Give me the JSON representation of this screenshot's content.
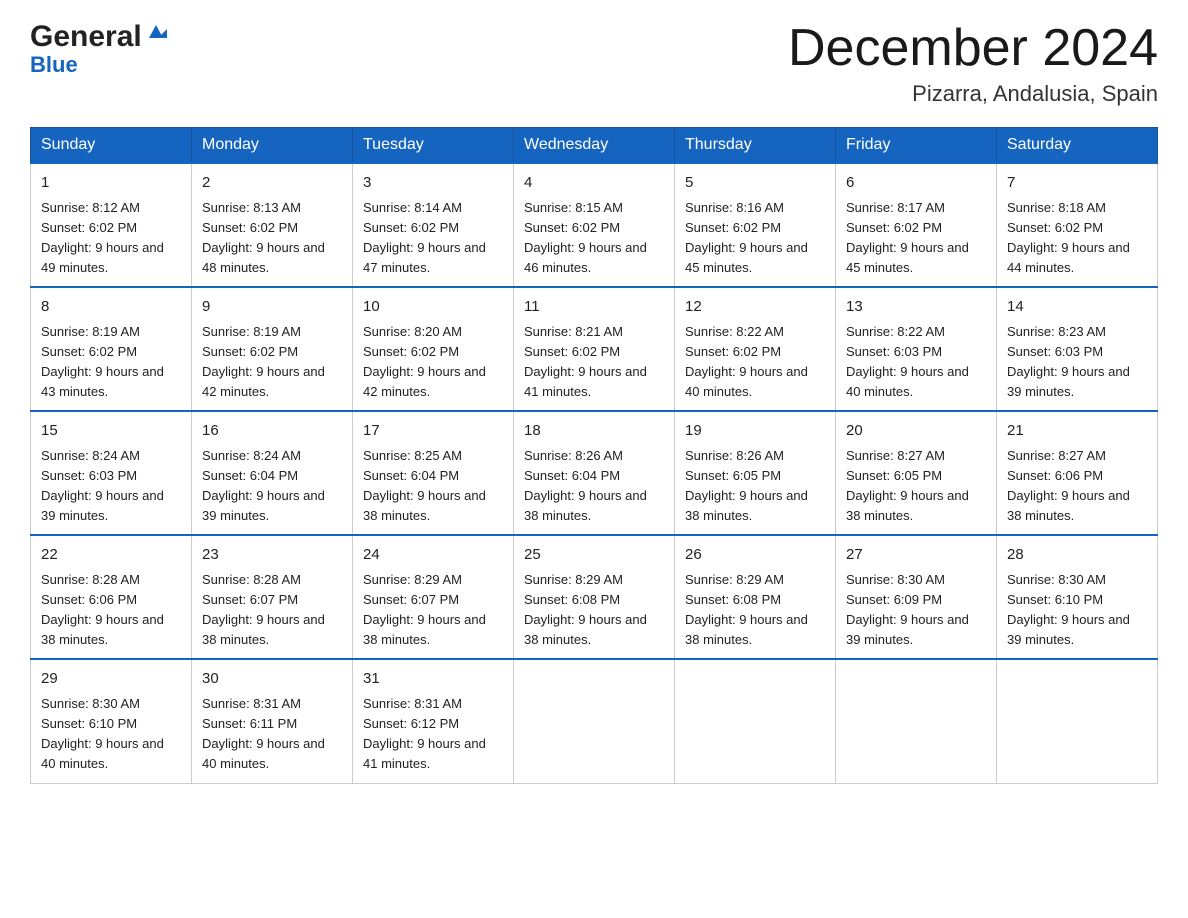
{
  "header": {
    "logo_general": "General",
    "logo_blue": "Blue",
    "month_title": "December 2024",
    "location": "Pizarra, Andalusia, Spain"
  },
  "days_of_week": [
    "Sunday",
    "Monday",
    "Tuesday",
    "Wednesday",
    "Thursday",
    "Friday",
    "Saturday"
  ],
  "weeks": [
    [
      {
        "day": "1",
        "sunrise": "Sunrise: 8:12 AM",
        "sunset": "Sunset: 6:02 PM",
        "daylight": "Daylight: 9 hours and 49 minutes."
      },
      {
        "day": "2",
        "sunrise": "Sunrise: 8:13 AM",
        "sunset": "Sunset: 6:02 PM",
        "daylight": "Daylight: 9 hours and 48 minutes."
      },
      {
        "day": "3",
        "sunrise": "Sunrise: 8:14 AM",
        "sunset": "Sunset: 6:02 PM",
        "daylight": "Daylight: 9 hours and 47 minutes."
      },
      {
        "day": "4",
        "sunrise": "Sunrise: 8:15 AM",
        "sunset": "Sunset: 6:02 PM",
        "daylight": "Daylight: 9 hours and 46 minutes."
      },
      {
        "day": "5",
        "sunrise": "Sunrise: 8:16 AM",
        "sunset": "Sunset: 6:02 PM",
        "daylight": "Daylight: 9 hours and 45 minutes."
      },
      {
        "day": "6",
        "sunrise": "Sunrise: 8:17 AM",
        "sunset": "Sunset: 6:02 PM",
        "daylight": "Daylight: 9 hours and 45 minutes."
      },
      {
        "day": "7",
        "sunrise": "Sunrise: 8:18 AM",
        "sunset": "Sunset: 6:02 PM",
        "daylight": "Daylight: 9 hours and 44 minutes."
      }
    ],
    [
      {
        "day": "8",
        "sunrise": "Sunrise: 8:19 AM",
        "sunset": "Sunset: 6:02 PM",
        "daylight": "Daylight: 9 hours and 43 minutes."
      },
      {
        "day": "9",
        "sunrise": "Sunrise: 8:19 AM",
        "sunset": "Sunset: 6:02 PM",
        "daylight": "Daylight: 9 hours and 42 minutes."
      },
      {
        "day": "10",
        "sunrise": "Sunrise: 8:20 AM",
        "sunset": "Sunset: 6:02 PM",
        "daylight": "Daylight: 9 hours and 42 minutes."
      },
      {
        "day": "11",
        "sunrise": "Sunrise: 8:21 AM",
        "sunset": "Sunset: 6:02 PM",
        "daylight": "Daylight: 9 hours and 41 minutes."
      },
      {
        "day": "12",
        "sunrise": "Sunrise: 8:22 AM",
        "sunset": "Sunset: 6:02 PM",
        "daylight": "Daylight: 9 hours and 40 minutes."
      },
      {
        "day": "13",
        "sunrise": "Sunrise: 8:22 AM",
        "sunset": "Sunset: 6:03 PM",
        "daylight": "Daylight: 9 hours and 40 minutes."
      },
      {
        "day": "14",
        "sunrise": "Sunrise: 8:23 AM",
        "sunset": "Sunset: 6:03 PM",
        "daylight": "Daylight: 9 hours and 39 minutes."
      }
    ],
    [
      {
        "day": "15",
        "sunrise": "Sunrise: 8:24 AM",
        "sunset": "Sunset: 6:03 PM",
        "daylight": "Daylight: 9 hours and 39 minutes."
      },
      {
        "day": "16",
        "sunrise": "Sunrise: 8:24 AM",
        "sunset": "Sunset: 6:04 PM",
        "daylight": "Daylight: 9 hours and 39 minutes."
      },
      {
        "day": "17",
        "sunrise": "Sunrise: 8:25 AM",
        "sunset": "Sunset: 6:04 PM",
        "daylight": "Daylight: 9 hours and 38 minutes."
      },
      {
        "day": "18",
        "sunrise": "Sunrise: 8:26 AM",
        "sunset": "Sunset: 6:04 PM",
        "daylight": "Daylight: 9 hours and 38 minutes."
      },
      {
        "day": "19",
        "sunrise": "Sunrise: 8:26 AM",
        "sunset": "Sunset: 6:05 PM",
        "daylight": "Daylight: 9 hours and 38 minutes."
      },
      {
        "day": "20",
        "sunrise": "Sunrise: 8:27 AM",
        "sunset": "Sunset: 6:05 PM",
        "daylight": "Daylight: 9 hours and 38 minutes."
      },
      {
        "day": "21",
        "sunrise": "Sunrise: 8:27 AM",
        "sunset": "Sunset: 6:06 PM",
        "daylight": "Daylight: 9 hours and 38 minutes."
      }
    ],
    [
      {
        "day": "22",
        "sunrise": "Sunrise: 8:28 AM",
        "sunset": "Sunset: 6:06 PM",
        "daylight": "Daylight: 9 hours and 38 minutes."
      },
      {
        "day": "23",
        "sunrise": "Sunrise: 8:28 AM",
        "sunset": "Sunset: 6:07 PM",
        "daylight": "Daylight: 9 hours and 38 minutes."
      },
      {
        "day": "24",
        "sunrise": "Sunrise: 8:29 AM",
        "sunset": "Sunset: 6:07 PM",
        "daylight": "Daylight: 9 hours and 38 minutes."
      },
      {
        "day": "25",
        "sunrise": "Sunrise: 8:29 AM",
        "sunset": "Sunset: 6:08 PM",
        "daylight": "Daylight: 9 hours and 38 minutes."
      },
      {
        "day": "26",
        "sunrise": "Sunrise: 8:29 AM",
        "sunset": "Sunset: 6:08 PM",
        "daylight": "Daylight: 9 hours and 38 minutes."
      },
      {
        "day": "27",
        "sunrise": "Sunrise: 8:30 AM",
        "sunset": "Sunset: 6:09 PM",
        "daylight": "Daylight: 9 hours and 39 minutes."
      },
      {
        "day": "28",
        "sunrise": "Sunrise: 8:30 AM",
        "sunset": "Sunset: 6:10 PM",
        "daylight": "Daylight: 9 hours and 39 minutes."
      }
    ],
    [
      {
        "day": "29",
        "sunrise": "Sunrise: 8:30 AM",
        "sunset": "Sunset: 6:10 PM",
        "daylight": "Daylight: 9 hours and 40 minutes."
      },
      {
        "day": "30",
        "sunrise": "Sunrise: 8:31 AM",
        "sunset": "Sunset: 6:11 PM",
        "daylight": "Daylight: 9 hours and 40 minutes."
      },
      {
        "day": "31",
        "sunrise": "Sunrise: 8:31 AM",
        "sunset": "Sunset: 6:12 PM",
        "daylight": "Daylight: 9 hours and 41 minutes."
      },
      null,
      null,
      null,
      null
    ]
  ]
}
